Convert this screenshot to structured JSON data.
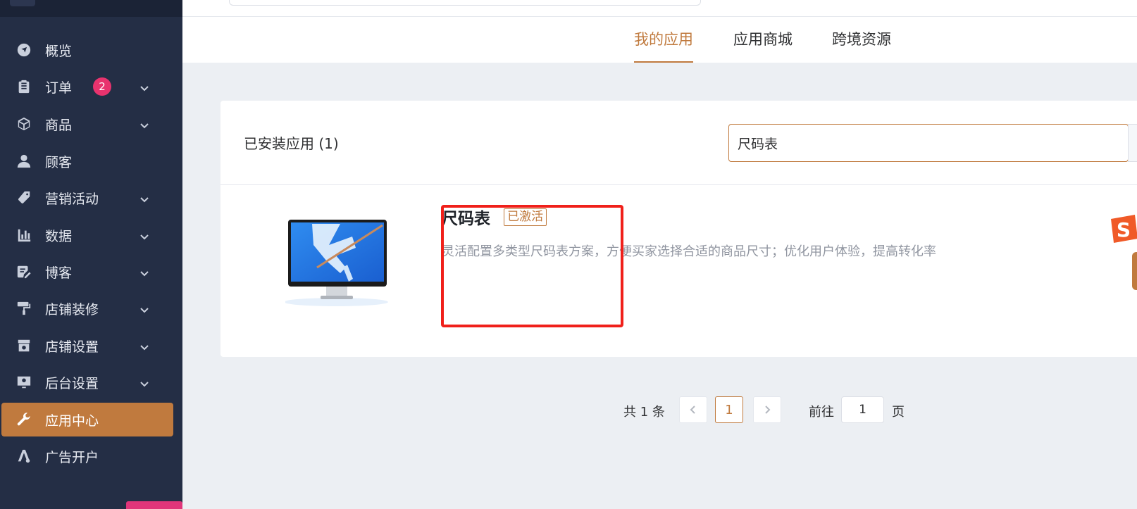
{
  "sidebar": {
    "items": [
      {
        "label": "概览",
        "icon": "navigation-arrow-icon",
        "has_chevron": false
      },
      {
        "label": "订单",
        "icon": "clipboard-icon",
        "has_chevron": true,
        "badge": "2"
      },
      {
        "label": "商品",
        "icon": "package-box-icon",
        "has_chevron": true
      },
      {
        "label": "顾客",
        "icon": "user-icon",
        "has_chevron": false
      },
      {
        "label": "营销活动",
        "icon": "tag-icon",
        "has_chevron": true
      },
      {
        "label": "数据",
        "icon": "bar-chart-icon",
        "has_chevron": true
      },
      {
        "label": "博客",
        "icon": "edit-document-icon",
        "has_chevron": true
      },
      {
        "label": "店铺装修",
        "icon": "paint-roller-icon",
        "has_chevron": true
      },
      {
        "label": "店铺设置",
        "icon": "store-settings-icon",
        "has_chevron": true
      },
      {
        "label": "后台设置",
        "icon": "monitor-settings-icon",
        "has_chevron": true
      },
      {
        "label": "应用中心",
        "icon": "wrench-icon",
        "has_chevron": false,
        "active": true
      },
      {
        "label": "广告开户",
        "icon": "ads-icon",
        "has_chevron": false
      }
    ]
  },
  "tabs": [
    {
      "label": "我的应用",
      "active": true
    },
    {
      "label": "应用商城",
      "active": false
    },
    {
      "label": "跨境资源",
      "active": false
    }
  ],
  "installed": {
    "title": "已安装应用 (1)",
    "search_value": "尺码表"
  },
  "app": {
    "name": "尺码表",
    "status": "已激活",
    "description": "灵活配置多类型尺码表方案，方便买家选择合适的商品尺寸；优化用户体验，提高转化率"
  },
  "pagination": {
    "total": "共 1 条",
    "current_page": "1",
    "goto_label": "前往",
    "goto_value": "1",
    "page_unit": "页"
  },
  "colors": {
    "sidebar_bg": "#242e45",
    "accent": "#c07a3e",
    "badge": "#e8336e",
    "highlight": "#f0201a"
  }
}
